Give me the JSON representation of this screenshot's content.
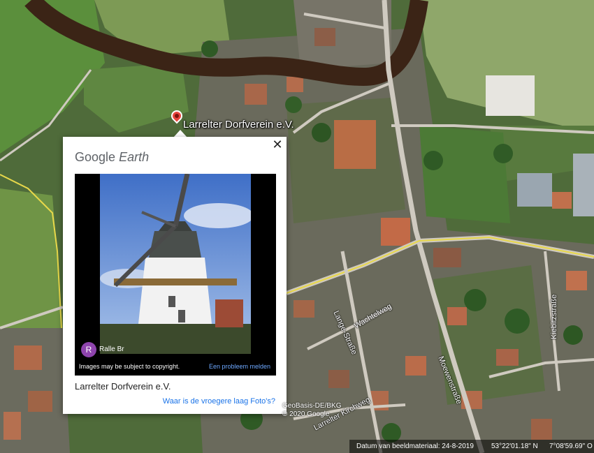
{
  "map": {
    "placemark_label": "Larrelter Dorfverein e.V.",
    "streets": {
      "wachtelweg": "Wachtelweg",
      "lange_strasse": "Lange-Straße",
      "moeweweg": "Moewenstraße",
      "kiebitzstrasse": "Kiebitzstraße",
      "kirchweg": "Larrelter Kirchweg"
    },
    "attribution_line1": "GeoBasis-DE/BKG",
    "attribution_line2": "© 2020 Google"
  },
  "popup": {
    "brand_google": "Google",
    "brand_earth": "Earth",
    "close_symbol": "✕",
    "photo_alt": "windmill-photo",
    "author_initial": "R",
    "author_name": "Ralle Br",
    "copyright_notice": "Images may be subject to copyright.",
    "report_link": "Een probleem melden",
    "title": "Larrelter Dorfverein e.V.",
    "older_layer_link": "Waar is de vroegere laag Foto's?"
  },
  "status": {
    "imagery_date": "Datum van beeldmateriaal: 24-8-2019",
    "latitude": "53°22'01.18\" N",
    "longitude": "7°08'59.69\" O"
  },
  "colors": {
    "river": "#3b2416",
    "road": "#cfcac0",
    "major_road": "#e8d84a",
    "author_avatar": "#8e44ad",
    "link": "#1a73e8"
  }
}
